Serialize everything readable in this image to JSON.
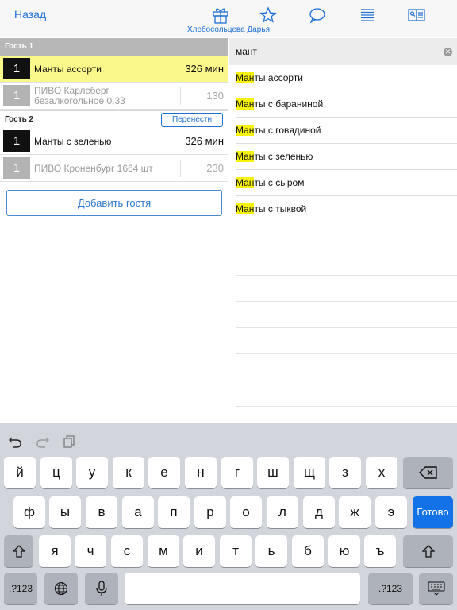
{
  "nav": {
    "back_label": "Назад",
    "waiter_name": "Хлебосольцева Дарья",
    "icons": [
      "gift-icon",
      "star-icon",
      "speech-bubble-icon",
      "list-icon",
      "menu-book-icon"
    ],
    "accent_color": "#1d6fd6"
  },
  "order": {
    "guests": [
      {
        "title": "Гость 1",
        "items": [
          {
            "qty": "1",
            "name": "Манты ассорти",
            "price": "326 мин",
            "state": "selected"
          },
          {
            "qty": "1",
            "name": "ПИВО Карлсберг безалкогольное 0,33",
            "price": "130",
            "state": "sent"
          }
        ]
      },
      {
        "title": "Гость 2",
        "transfer_label": "Перенести",
        "items": [
          {
            "qty": "1",
            "name": "Манты с зеленью",
            "price": "326 мин",
            "state": "new"
          },
          {
            "qty": "1",
            "name": "ПИВО Кроненбург 1664 шт",
            "price": "230",
            "state": "sent"
          }
        ]
      }
    ],
    "add_guest_label": "Добавить гостя",
    "selected_row_color": "#fbf88b"
  },
  "search": {
    "query": "мант",
    "highlight_color": "#f7f40a",
    "results": [
      {
        "match": "Ман",
        "rest": "ты ассорти"
      },
      {
        "match": "Ман",
        "rest": "ты с бараниной"
      },
      {
        "match": "Ман",
        "rest": "ты с говядиной"
      },
      {
        "match": "Ман",
        "rest": "ты с зеленью"
      },
      {
        "match": "Ман",
        "rest": "ты с сыром"
      },
      {
        "match": "Ман",
        "rest": "ты с тыквой"
      }
    ]
  },
  "keyboard": {
    "toolbar_icons": [
      "undo-icon",
      "redo-icon",
      "paste-icon"
    ],
    "row1": [
      "й",
      "ц",
      "у",
      "к",
      "е",
      "н",
      "г",
      "ш",
      "щ",
      "з",
      "х"
    ],
    "row2": [
      "ф",
      "ы",
      "в",
      "а",
      "п",
      "р",
      "о",
      "л",
      "д",
      "ж",
      "э"
    ],
    "row3": [
      "я",
      "ч",
      "с",
      "м",
      "и",
      "т",
      "ь",
      "б",
      "ю",
      "ъ"
    ],
    "return_label": "Готово",
    "numbers_label": ".?123",
    "return_color": "#1472e8"
  }
}
